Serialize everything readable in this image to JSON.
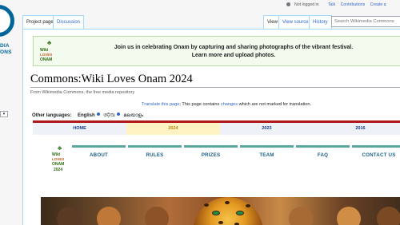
{
  "sidebar": {
    "logo_text_line1": "DIA",
    "logo_text_line2": "ONS",
    "language_select_value": "",
    "links": [
      "",
      "",
      "",
      "",
      "",
      ""
    ]
  },
  "personal": {
    "not_logged_in": "Not logged in",
    "talk": "Talk",
    "contributions": "Contributions",
    "create_account": "Create a"
  },
  "tabs": {
    "project_page": "Project page",
    "discussion": "Discussion",
    "view": "View",
    "view_source": "View source",
    "history": "History"
  },
  "search": {
    "placeholder": "Search Wikimedia Commons"
  },
  "banner": {
    "logo_line1": "Wiki",
    "logo_line2": "LOVES",
    "logo_line3": "ONAM",
    "text_line1": "Join us in celebrating Onam by capturing and sharing photographs of the vibrant festival.",
    "text_line2": "Learn more and upload photos."
  },
  "page": {
    "title": "Commons:Wiki Loves Onam 2024",
    "site_sub": "From Wikimedia Commons, the free media repository",
    "translate_link": "Translate this page",
    "translate_mid": "; This page contains ",
    "changes_link": "changes",
    "translate_tail": " which are not marked for translation."
  },
  "other_languages": {
    "label": "Other languages:",
    "items": [
      "English",
      "ଓଡ଼ିଆ",
      "മലയാളം"
    ]
  },
  "year_nav": {
    "items": [
      "HOME",
      "2024",
      "2023",
      "2016"
    ],
    "active_index": 1
  },
  "onam_logo": {
    "line1": "Wiki",
    "line2": "LOVES",
    "line3": "ONAM",
    "line4": "2024"
  },
  "menu": {
    "items": [
      "ABOUT",
      "RULES",
      "PRIZES",
      "TEAM",
      "FAQ",
      "CONTACT US"
    ]
  },
  "colors": {
    "link": "#3366cc",
    "year_rule": "#b01919",
    "active_year_bg": "#fff3c4",
    "menu_rule": "#5aa7a0",
    "menu_text": "#1e5f86",
    "banner_bg": "#f3fbef"
  }
}
